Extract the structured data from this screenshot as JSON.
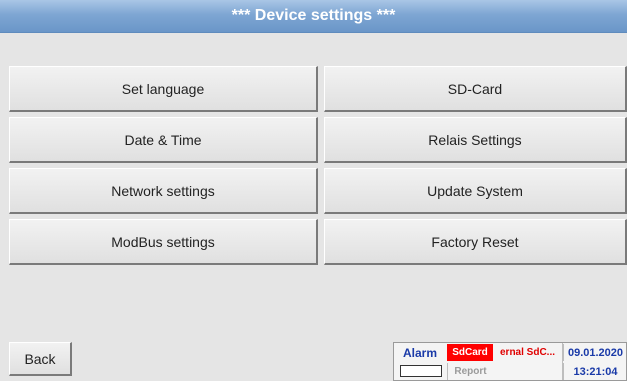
{
  "header": {
    "title": "***  Device settings  ***",
    "color": "#7ea6d3"
  },
  "menu": {
    "left": [
      "Set language",
      "Date & Time",
      "Network settings",
      "ModBus settings"
    ],
    "right": [
      "SD-Card",
      "Relais Settings",
      "Update System",
      "Factory Reset"
    ]
  },
  "footer": {
    "back_label": "Back",
    "alarm_label": "Alarm",
    "alarm_segments": 4,
    "sdcard_label": "SdCard",
    "report_label": "Report",
    "external_sd_label": "ernal SdC...",
    "date": "09.01.2020",
    "time": "13:21:04",
    "colors": {
      "sdcard_bg": "#ff0000",
      "alarm_ok": "#29c329",
      "status_text": "#1a3aa8"
    }
  }
}
